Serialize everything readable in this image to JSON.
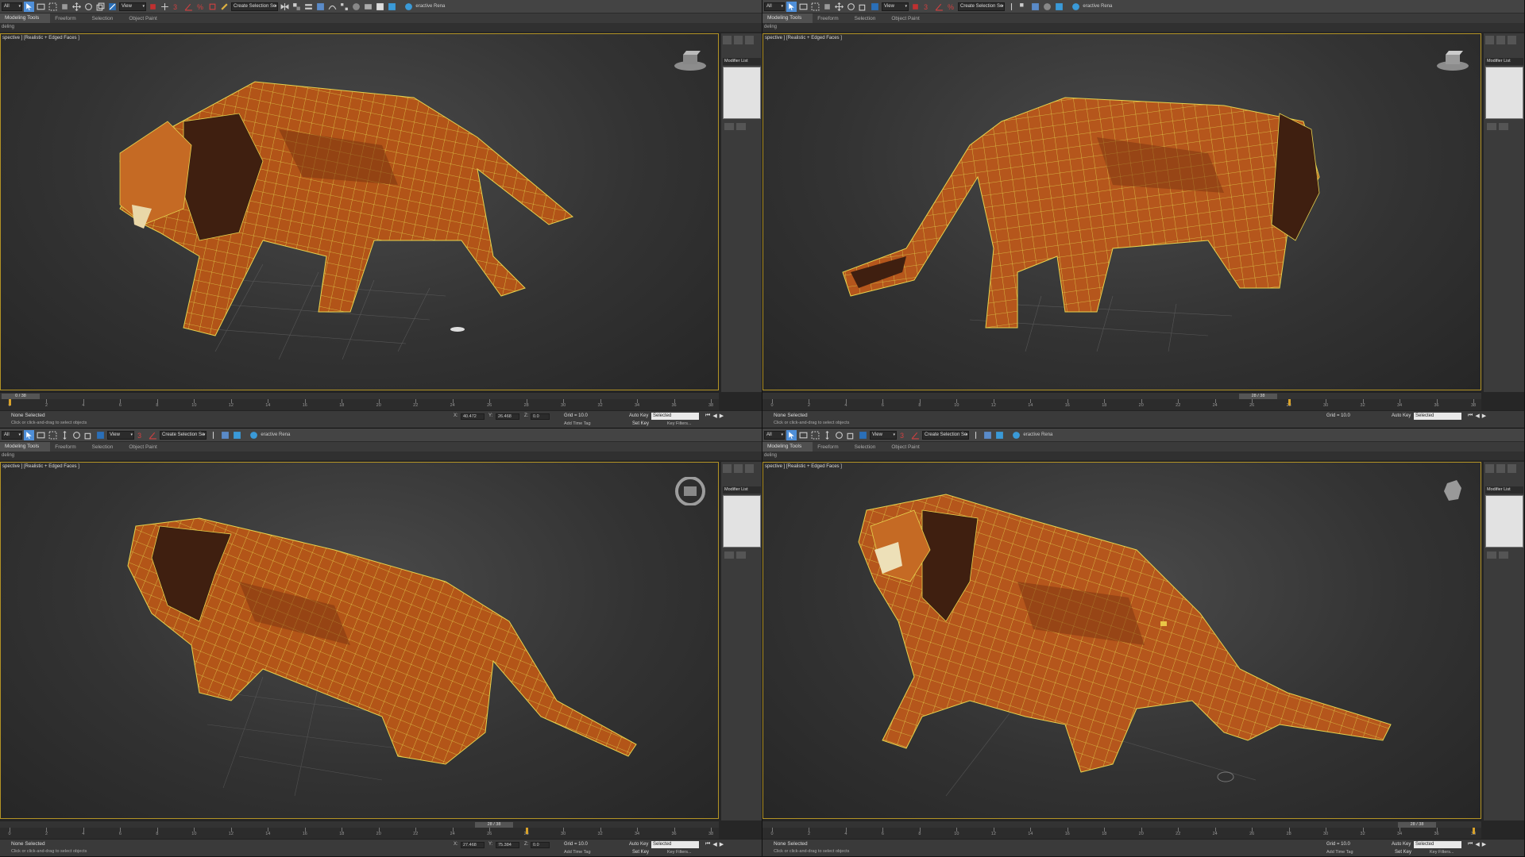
{
  "toolbar": {
    "filter_value": "All",
    "view_value": "View",
    "selection_set_placeholder": "Create Selection Se",
    "interactive_label": "eractive Rena",
    "icons": [
      "select-icon",
      "select-by-name-icon",
      "rect-region-icon",
      "window-crossing-icon",
      "move-icon",
      "rotate-icon",
      "scale-icon",
      "select-manipulate-icon",
      "snaps-3-icon",
      "angle-snap-icon",
      "percent-snap-icon",
      "spinner-snap-icon",
      "edit-named-selection-icon",
      "mirror-icon",
      "align-icon",
      "layer-icon",
      "scene-explorer-icon",
      "curve-editor-icon",
      "schematic-icon",
      "material-editor-icon",
      "render-setup-icon",
      "rendered-frame-icon",
      "render-icon"
    ]
  },
  "ribbon": {
    "tabs": [
      "Modeling Tools",
      "Freeform",
      "Selection",
      "Object Paint"
    ],
    "active_tab": "Modeling Tools",
    "sub_label": "deling"
  },
  "viewport": {
    "label": "spective ] [Realistic + Edged Faces ]"
  },
  "command_panel": {
    "modifier_list": "Modifier List"
  },
  "timeline": {
    "frame_counter": "0 / 38",
    "frame_counter_alt": "28 / 38",
    "ticks": [
      "0",
      "2",
      "4",
      "6",
      "8",
      "10",
      "12",
      "14",
      "16",
      "18",
      "20",
      "22",
      "24",
      "26",
      "28",
      "30",
      "32",
      "34",
      "36",
      "38"
    ]
  },
  "status": {
    "selection": "None Selected",
    "prompt": "Click or click-and-drag to select objects",
    "grid": "Grid = 10.0",
    "add_time_tag": "Add Time Tag",
    "auto_key": "Auto Key",
    "set_key": "Set Key",
    "selected": "Selected",
    "key_filters": "Key Filters...",
    "x_label": "X:",
    "y_label": "Y:",
    "z_label": "Z:",
    "q1": {
      "x": "40.472",
      "y": "26.468",
      "z": "0.0"
    },
    "q3": {
      "x": "27.468",
      "y": "75.384",
      "z": "0.0"
    }
  },
  "colors": {
    "accent": "#4f8fd8",
    "viewport_border": "#b39325",
    "lion_body": "#b5561c",
    "wire": "#e2d24c",
    "mane": "#4a2612"
  }
}
